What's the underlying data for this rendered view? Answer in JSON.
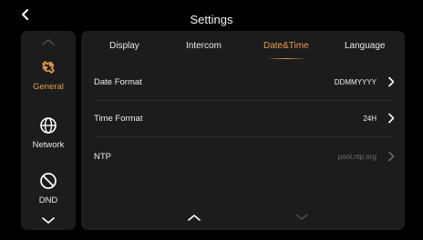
{
  "header": {
    "title": "Settings"
  },
  "sidebar": {
    "items": [
      {
        "label": "General",
        "icon": "wrench-icon",
        "active": true
      },
      {
        "label": "Network",
        "icon": "globe-icon",
        "active": false
      },
      {
        "label": "DND",
        "icon": "do-not-disturb-icon",
        "active": false
      }
    ]
  },
  "tabs": [
    {
      "label": "Display",
      "active": false
    },
    {
      "label": "Intercom",
      "active": false
    },
    {
      "label": "Date&Time",
      "active": true
    },
    {
      "label": "Language",
      "active": false
    }
  ],
  "rows": [
    {
      "label": "Date Format",
      "value": "DDMMYYYY",
      "enabled": true
    },
    {
      "label": "Time Format",
      "value": "24H",
      "enabled": true
    },
    {
      "label": "NTP",
      "value": "pool.ntp.org",
      "enabled": false
    }
  ],
  "colors": {
    "accent": "#e79a4e",
    "panel": "#1c1c1c",
    "background": "#000000"
  }
}
